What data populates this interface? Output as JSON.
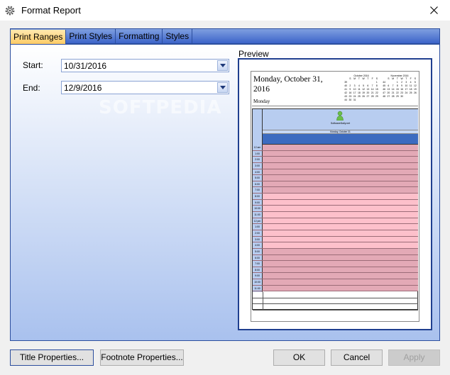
{
  "window": {
    "title": "Format Report"
  },
  "tabs": [
    {
      "label": "Print Ranges",
      "active": true
    },
    {
      "label": "Print Styles",
      "active": false
    },
    {
      "label": "Formatting",
      "active": false
    },
    {
      "label": "Styles",
      "active": false
    }
  ],
  "range": {
    "start_label": "Start:",
    "start_value": "10/31/2016",
    "end_label": "End:",
    "end_value": "12/9/2016"
  },
  "preview": {
    "label": "Preview",
    "date_title": "Monday, October 31, 2016",
    "day_name": "Monday",
    "resource_name": "SoftwareDaily.net",
    "column_date": "Monday, October 31",
    "minical_left": {
      "title": "October 2016",
      "header": [
        "",
        "S",
        "M",
        "T",
        "W",
        "T",
        "F",
        "S"
      ],
      "rows": [
        [
          "39",
          "",
          "",
          "",
          "",
          "",
          "",
          "1"
        ],
        [
          "40",
          "2",
          "3",
          "4",
          "5",
          "6",
          "7",
          "8"
        ],
        [
          "41",
          "9",
          "10",
          "11",
          "12",
          "13",
          "14",
          "15"
        ],
        [
          "42",
          "16",
          "17",
          "18",
          "19",
          "20",
          "21",
          "22"
        ],
        [
          "43",
          "23",
          "24",
          "25",
          "26",
          "27",
          "28",
          "29"
        ],
        [
          "44",
          "30",
          "31",
          "",
          "",
          "",
          "",
          ""
        ]
      ]
    },
    "minical_right": {
      "title": "November 2016",
      "header": [
        "",
        "S",
        "M",
        "T",
        "W",
        "T",
        "F",
        "S"
      ],
      "rows": [
        [
          "44",
          "",
          "",
          "1",
          "2",
          "3",
          "4",
          "5"
        ],
        [
          "45",
          "6",
          "7",
          "8",
          "9",
          "10",
          "11",
          "12"
        ],
        [
          "46",
          "13",
          "14",
          "15",
          "16",
          "17",
          "18",
          "19"
        ],
        [
          "47",
          "20",
          "21",
          "22",
          "23",
          "24",
          "25",
          "26"
        ],
        [
          "48",
          "27",
          "28",
          "29",
          "30",
          "",
          "",
          ""
        ]
      ]
    },
    "time_slots": [
      {
        "t": "12 am",
        "bg": "#e3a9b6"
      },
      {
        "t": "1:00",
        "bg": "#e3a9b6"
      },
      {
        "t": "2:00",
        "bg": "#e3a9b6"
      },
      {
        "t": "3:00",
        "bg": "#e3a9b6"
      },
      {
        "t": "4:00",
        "bg": "#e3a9b6"
      },
      {
        "t": "5:00",
        "bg": "#e3a9b6"
      },
      {
        "t": "6:00",
        "bg": "#e3a9b6"
      },
      {
        "t": "7:00",
        "bg": "#e3a9b6"
      },
      {
        "t": "8:00",
        "bg": "#fdc0cb"
      },
      {
        "t": "9:00",
        "bg": "#fdc0cb"
      },
      {
        "t": "10:00",
        "bg": "#fdc0cb"
      },
      {
        "t": "11:00",
        "bg": "#fdc0cb"
      },
      {
        "t": "12 pm",
        "bg": "#fdc0cb"
      },
      {
        "t": "1:00",
        "bg": "#fdc0cb"
      },
      {
        "t": "2:00",
        "bg": "#fdc0cb"
      },
      {
        "t": "3:00",
        "bg": "#fdc0cb"
      },
      {
        "t": "4:00",
        "bg": "#fdc0cb"
      },
      {
        "t": "5:00",
        "bg": "#e3a9b6"
      },
      {
        "t": "6:00",
        "bg": "#e3a9b6"
      },
      {
        "t": "7:00",
        "bg": "#e3a9b6"
      },
      {
        "t": "8:00",
        "bg": "#e3a9b6"
      },
      {
        "t": "9:00",
        "bg": "#e3a9b6"
      },
      {
        "t": "10:00",
        "bg": "#e3a9b6"
      },
      {
        "t": "11:00",
        "bg": "#e3a9b6"
      }
    ]
  },
  "buttons": {
    "title_properties": "Title Properties...",
    "footnote_properties": "Footnote Properties...",
    "ok": "OK",
    "cancel": "Cancel",
    "apply": "Apply"
  },
  "colors": {
    "tab_active": "#ffcc66",
    "tab_strip": "#3c63c9",
    "allday_bar": "#3c6bc0",
    "work_hours": "#fdc0cb",
    "off_hours": "#e3a9b6"
  }
}
